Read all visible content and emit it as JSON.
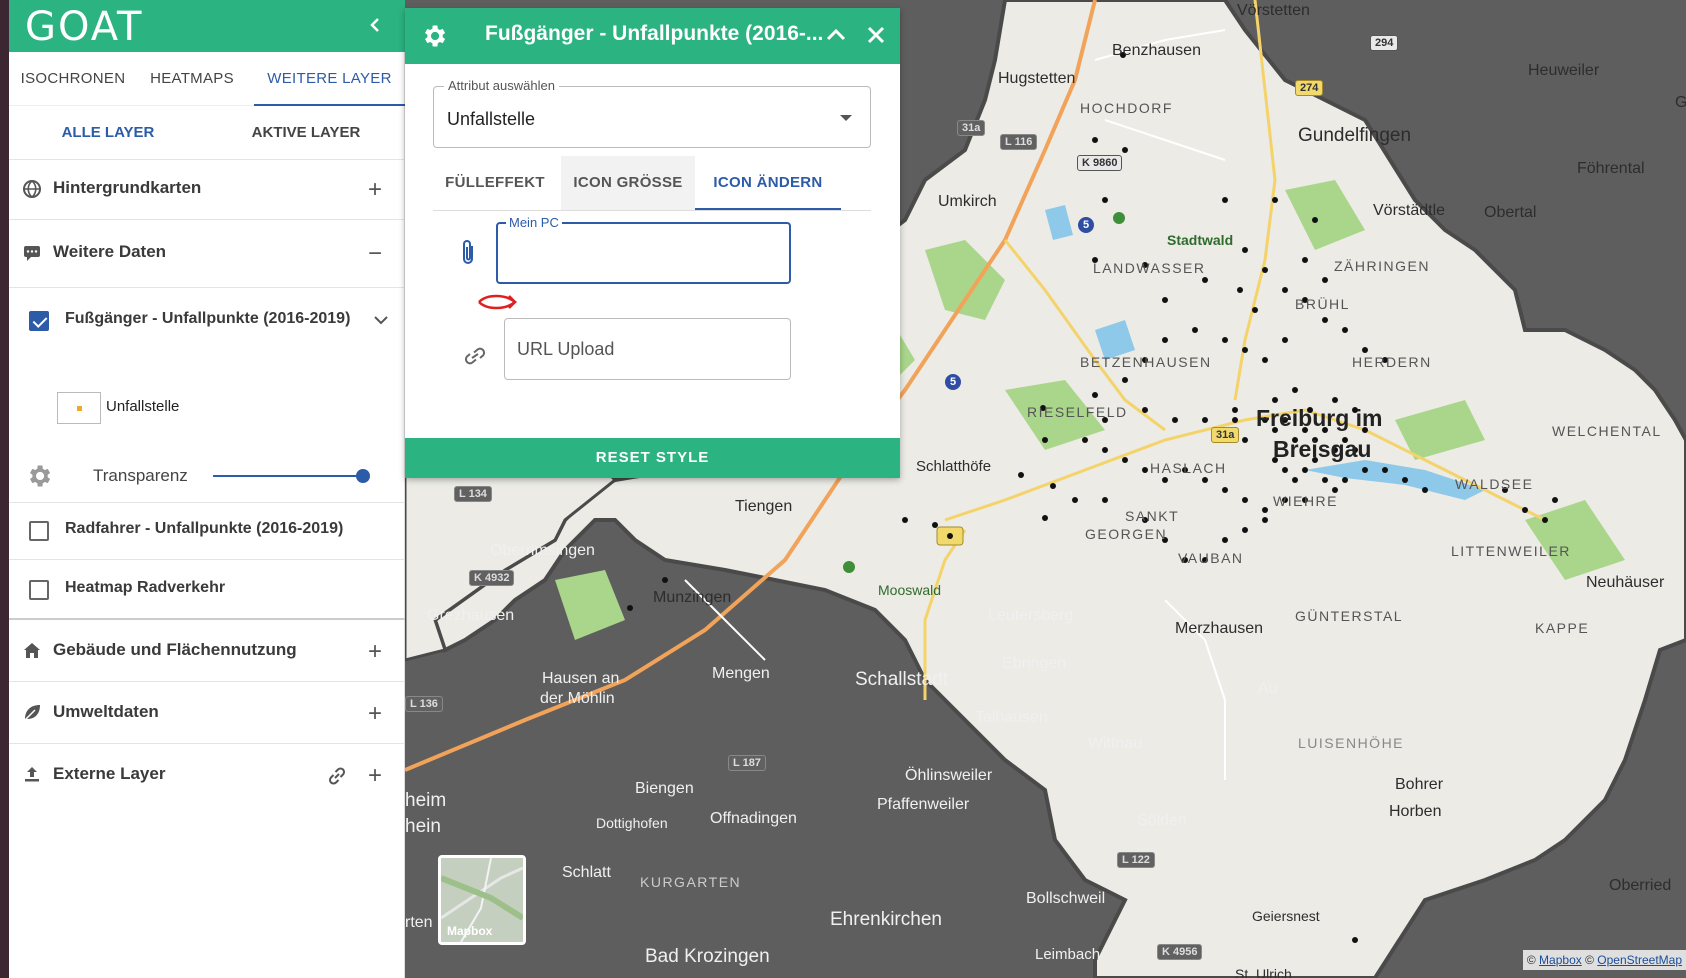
{
  "app": {
    "logo": "GOAT"
  },
  "sidebar": {
    "tabs": [
      "ISOCHRONEN",
      "HEATMAPS",
      "WEITERE LAYER"
    ],
    "active_tab": "WEITERE LAYER",
    "subtabs": [
      "ALLE LAYER",
      "AKTIVE LAYER"
    ],
    "groups": [
      {
        "label": "Hintergrundkarten",
        "icon": "globe-icon",
        "action": "+"
      },
      {
        "label": "Weitere Daten",
        "icon": "chat-bubble-icon",
        "action": "−"
      },
      {
        "label": "Gebäude und Flächennutzung",
        "icon": "home-icon",
        "action": "+"
      },
      {
        "label": "Umweltdaten",
        "icon": "leaf-icon",
        "action": "+"
      },
      {
        "label": "Externe Layer",
        "icon": "upload-icon",
        "action": "+"
      }
    ],
    "layers": [
      {
        "label": "Fußgänger - Unfallpunkte (2016-2019)",
        "checked": true
      },
      {
        "label": "Radfahrer - Unfallpunkte (2016-2019)",
        "checked": false
      },
      {
        "label": "Heatmap Radverkehr",
        "checked": false
      }
    ],
    "legend": {
      "label": "Unfallstelle",
      "color": "#f5a623"
    },
    "transparency": {
      "label": "Transparenz",
      "value": 1.0
    }
  },
  "dialog": {
    "title": "Fußgänger - Unfallpunkte (2016-...",
    "attribute": {
      "label": "Attribut auswählen",
      "value": "Unfallstelle"
    },
    "tabs": [
      "FÜLLEFFEKT",
      "ICON GRÖSSE",
      "ICON ÄNDERN"
    ],
    "active_tab": "ICON ÄNDERN",
    "file_field": {
      "label": "Mein PC",
      "value": ""
    },
    "url_field": {
      "placeholder": "URL Upload"
    },
    "reset_label": "RESET STYLE"
  },
  "map": {
    "labels": {
      "benzhausen": "Benzhausen",
      "voerstetten": "Vörstetten",
      "hugstetten": "Hugstetten",
      "hochdorf": "HOCHDORF",
      "heuweiler": "Heuweiler",
      "gundelfingen": "Gundelfingen",
      "umkirch": "Umkirch",
      "foehrental": "Föhrental",
      "vorstaedtle": "Vörstädtle",
      "obertal": "Obertal",
      "stadtwald": "Stadtwald",
      "landwasser": "LANDWASSER",
      "zaehringen": "ZÄHRINGEN",
      "bruehl": "BRÜHL",
      "betzenhausen": "BETZENHAUSEN",
      "herdern": "HERDERN",
      "rieselfeld": "RIESELFELD",
      "freiburg1": "Freiburg im",
      "freiburg2": "Breisgau",
      "welchental": "WELCHENTAL",
      "schlatthoefe": "Schlatthöfe",
      "haslach": "HASLACH",
      "waldsee": "WALDSEE",
      "tiengen": "Tiengen",
      "stgeorgen1": "SANKT",
      "stgeorgen2": "GEORGEN",
      "wiehre": "WIEHRE",
      "oberrimsingen": "Oberrimsingen",
      "vauban": "VAUBAN",
      "littenweiler": "LITTENWEILER",
      "neuhaeuser": "Neuhäuser",
      "munzingen": "Munzingen",
      "mooswald": "Mooswald",
      "grezhausen": "Grezhausen",
      "leutersberg": "Leutersberg",
      "merzhausen": "Merzhausen",
      "guentersal": "GÜNTERSTAL",
      "kappel": "KAPPE",
      "ebringen": "Ebringen",
      "mengen": "Mengen",
      "schallstadt": "Schallstadt",
      "hausen1": "Hausen an",
      "hausen2": "der Möhlin",
      "au": "Au",
      "talhausen": "Talhausen",
      "wittnau": "Wittnau",
      "luisenhoehe": "LUISENHÖHE",
      "bohrer": "Bohrer",
      "horben": "Horben",
      "oehlinsweiler": "Öhlinsweiler",
      "pfaffenweiler": "Pfaffenweiler",
      "biengen": "Biengen",
      "heim1": "heim",
      "heim2": "hein",
      "dottighofen": "Dottighofen",
      "offnadingen": "Offnadingen",
      "soelden": "Sölden",
      "schlatt": "Schlatt",
      "kurgarten": "KURGARTEN",
      "bollschweil": "Bollschweil",
      "oberried": "Oberried",
      "ehrenkirchen": "Ehrenkirchen",
      "geiersnest": "Geiersnest",
      "rten": "rten",
      "leimbach": "Leimbach",
      "badkrozingen": "Bad Krozingen",
      "stulrich": "St. Ulrich",
      "wald": "wald",
      "g": "G"
    },
    "shields": {
      "a294": "294",
      "a31a": "31a",
      "l116": "L 116",
      "k9860": "K 9860",
      "a5a": "5",
      "l134": "L 134",
      "k4932": "K 4932",
      "a5b": "5",
      "a31a2": "31a",
      "l136": "L 136",
      "l187": "L 187",
      "l122": "L 122",
      "k4956": "K 4956",
      "e2": "274"
    },
    "minimap_label": "Mapbox",
    "attribution": {
      "prefix": "©",
      "mapbox": "Mapbox",
      "mid": "©",
      "osm": "OpenStreetMap"
    }
  }
}
